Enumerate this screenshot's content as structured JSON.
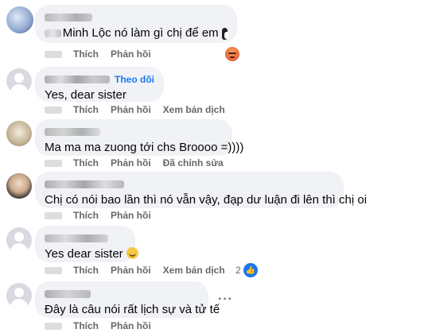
{
  "labels": {
    "like": "Thích",
    "reply": "Phản hồi",
    "see_translation": "Xem bản dịch",
    "edited": "Đã chỉnh sửa",
    "follow": "Theo dõi",
    "more": "···"
  },
  "comments": [
    {
      "text": "Minh Lộc nó làm gì chị để em",
      "reaction": "angry-icon"
    },
    {
      "text": "Yes, dear sister"
    },
    {
      "text": "Ma ma ma zuong tới chs Broooo =))))"
    },
    {
      "text": "Chị có nói bao lần thì nó vẫn vậy, đạp dư luận đi lên thì chị oi"
    },
    {
      "text": "Yes dear sister",
      "reaction_count": "2",
      "reaction": "like-icon"
    },
    {
      "text": "Đây là câu nói rất lịch sự và tử tế"
    }
  ],
  "colors": {
    "bubble": "#f0f2f5",
    "link": "#1877f2",
    "secondary": "#65676b"
  }
}
